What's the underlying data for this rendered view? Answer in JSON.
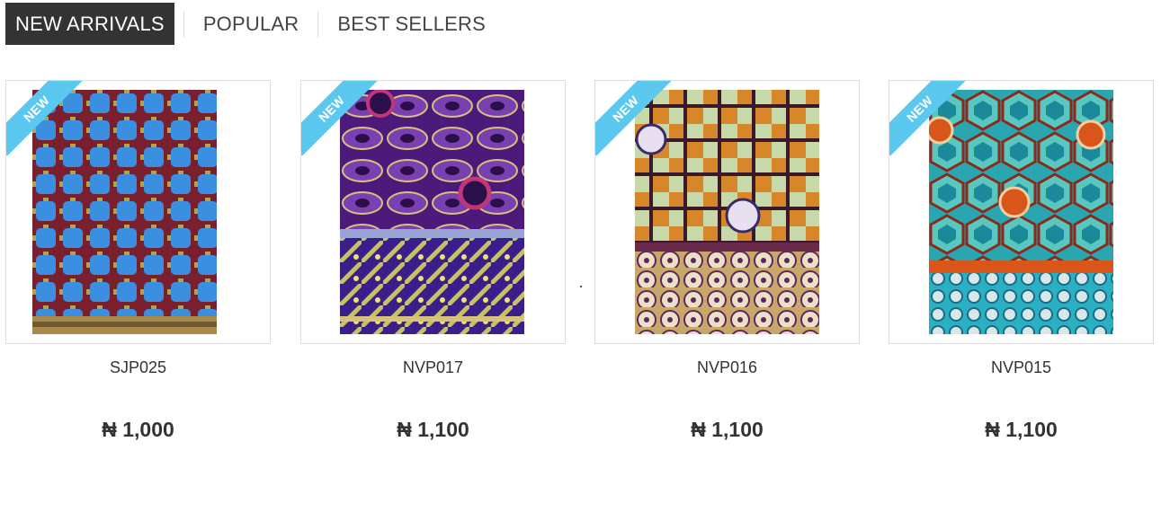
{
  "tabs": [
    {
      "label": "NEW ARRIVALS",
      "active": true
    },
    {
      "label": "POPULAR",
      "active": false
    },
    {
      "label": "BEST SELLERS",
      "active": false
    }
  ],
  "badge_label": "NEW",
  "products": [
    {
      "name": "SJP025",
      "price": "₦ 1,000",
      "fabric_icon": "fabric-image"
    },
    {
      "name": "NVP017",
      "price": "₦ 1,100",
      "fabric_icon": "fabric-image"
    },
    {
      "name": "NVP016",
      "price": "₦ 1,100",
      "fabric_icon": "fabric-image"
    },
    {
      "name": "NVP015",
      "price": "₦ 1,100",
      "fabric_icon": "fabric-image"
    }
  ],
  "colors": {
    "active_tab_bg": "#333333",
    "badge": "#5bc8ef"
  }
}
